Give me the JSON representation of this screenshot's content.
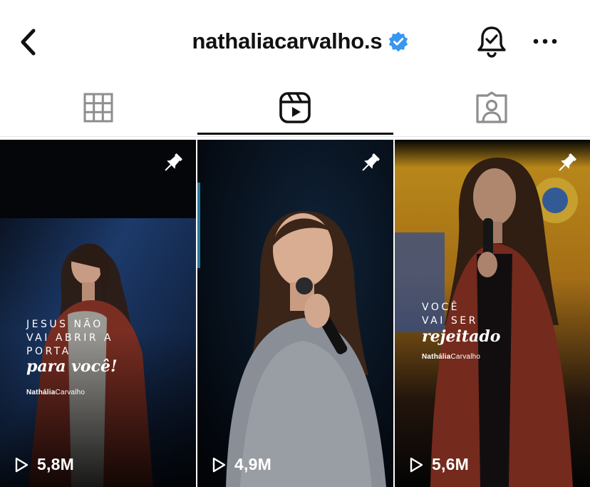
{
  "header": {
    "username": "nathaliacarvalho.s",
    "verified_color": "#3897f0"
  },
  "tabs": [
    {
      "icon": "grid-icon",
      "active": false
    },
    {
      "icon": "reels-icon",
      "active": true
    },
    {
      "icon": "tagged-icon",
      "active": false
    }
  ],
  "reels": [
    {
      "views": "5,8M",
      "pinned": true,
      "overlay_lines": [
        "JESUS NÃO",
        "VAI ABRIR A",
        "PORTA"
      ],
      "overlay_script": "para você!",
      "brand_bold": "Nathália",
      "brand_light": "Carvalho"
    },
    {
      "views": "4,9M",
      "pinned": true
    },
    {
      "views": "5,6M",
      "pinned": true,
      "overlay_lines": [
        "VOCÊ",
        "VAI SER"
      ],
      "overlay_script": "rejeitado",
      "brand_bold": "Nathália",
      "brand_light": "Carvalho"
    }
  ]
}
